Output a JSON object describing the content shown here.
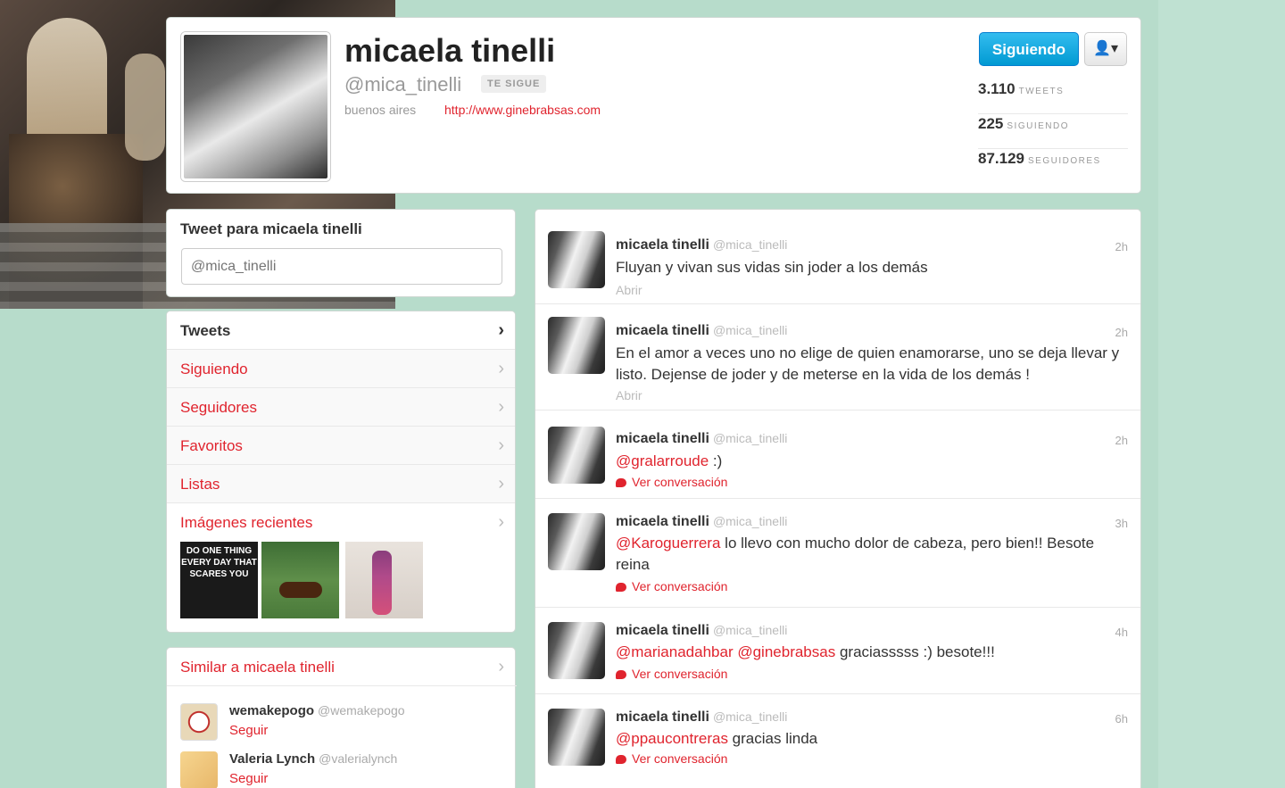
{
  "profile": {
    "name": "micaela tinelli",
    "handle": "@mica_tinelli",
    "follows_you": "TE SIGUE",
    "location": "buenos aires",
    "website": "http://www.ginebrabsas.com",
    "follow_button": "Siguiendo",
    "user_menu_icon": "user-dropdown-icon",
    "stats": [
      {
        "value": "3.110",
        "label": "TWEETS"
      },
      {
        "value": "225",
        "label": "SIGUIENDO"
      },
      {
        "value": "87.129",
        "label": "SEGUIDORES"
      }
    ]
  },
  "tweetbox": {
    "title": "Tweet para micaela tinelli",
    "placeholder": "@mica_tinelli"
  },
  "nav": {
    "items": [
      {
        "label": "Tweets"
      },
      {
        "label": "Siguiendo"
      },
      {
        "label": "Seguidores"
      },
      {
        "label": "Favoritos"
      },
      {
        "label": "Listas"
      },
      {
        "label": "Imágenes recientes"
      }
    ],
    "thumb1_text": "DO ONE THING EVERY DAY THAT SCARES YOU"
  },
  "similar": {
    "title": "Similar a micaela tinelli",
    "users": [
      {
        "name": "wemakepogo",
        "handle": "@wemakepogo",
        "action": "Seguir"
      },
      {
        "name": "Valeria Lynch",
        "handle": "@valerialynch",
        "action": "Seguir"
      }
    ]
  },
  "timeline": {
    "tweets": [
      {
        "name": "micaela tinelli",
        "handle": "@mica_tinelli",
        "time": "2h",
        "text": "Fluyan y vivan sus vidas sin joder a los demás",
        "footer": "Abrir"
      },
      {
        "name": "micaela tinelli",
        "handle": "@mica_tinelli",
        "time": "2h",
        "text": "En el amor a veces uno no elige de quien enamorarse, uno se deja llevar y listo. Dejense de joder y de meterse en la vida de los demás !",
        "footer": "Abrir"
      },
      {
        "name": "micaela tinelli",
        "handle": "@mica_tinelli",
        "time": "2h",
        "mention": "@gralarroude",
        "text": " :)",
        "footer": "Ver conversación"
      },
      {
        "name": "micaela tinelli",
        "handle": "@mica_tinelli",
        "time": "3h",
        "mention": "@Karoguerrera",
        "text": " lo llevo con mucho dolor de cabeza, pero bien!! Besote reina",
        "footer": "Ver conversación"
      },
      {
        "name": "micaela tinelli",
        "handle": "@mica_tinelli",
        "time": "4h",
        "mention": "@marianadahbar",
        "mention2": "@ginebrabsas",
        "text": " graciasssss :) besote!!!",
        "footer": "Ver conversación"
      },
      {
        "name": "micaela tinelli",
        "handle": "@mica_tinelli",
        "time": "6h",
        "mention": "@ppaucontreras",
        "text": " gracias linda",
        "footer": "Ver conversación"
      }
    ]
  }
}
